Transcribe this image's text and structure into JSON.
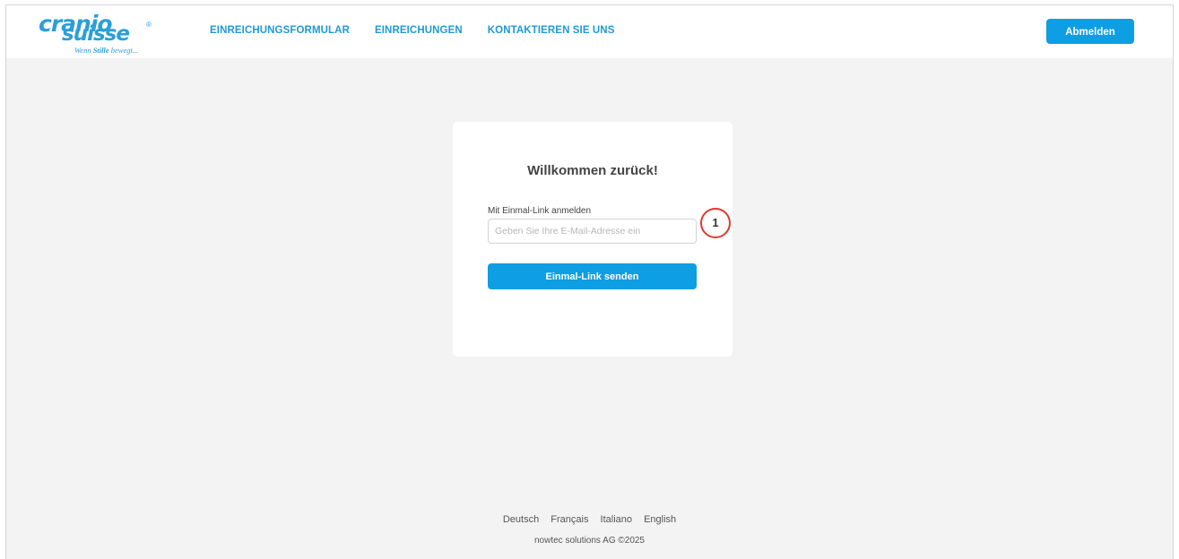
{
  "brand": {
    "logo_top": "cranio",
    "logo_bottom": "suisse",
    "logo_reg": "®",
    "tagline_pre": "Wenn ",
    "tagline_bold": "Stille",
    "tagline_post": " bewegt...",
    "accent_color": "#0d9ee4"
  },
  "nav": {
    "items": [
      {
        "label": "EINREICHUNGSFORMULAR"
      },
      {
        "label": "EINREICHUNGEN"
      },
      {
        "label": "KONTAKTIEREN SIE UNS"
      }
    ]
  },
  "header": {
    "logout_label": "Abmelden"
  },
  "login": {
    "title": "Willkommen zurück!",
    "field_label": "Mit Einmal-Link anmelden",
    "email_placeholder": "Geben Sie Ihre E-Mail-Adresse ein",
    "email_value": "",
    "submit_label": "Einmal-Link senden"
  },
  "annotation": {
    "marker": "1",
    "marker_color": "#e03a2f"
  },
  "footer": {
    "languages": [
      {
        "label": "Deutsch"
      },
      {
        "label": "Français"
      },
      {
        "label": "Italiano"
      },
      {
        "label": "English"
      }
    ],
    "copyright": "nowtec solutions AG ©2025"
  }
}
